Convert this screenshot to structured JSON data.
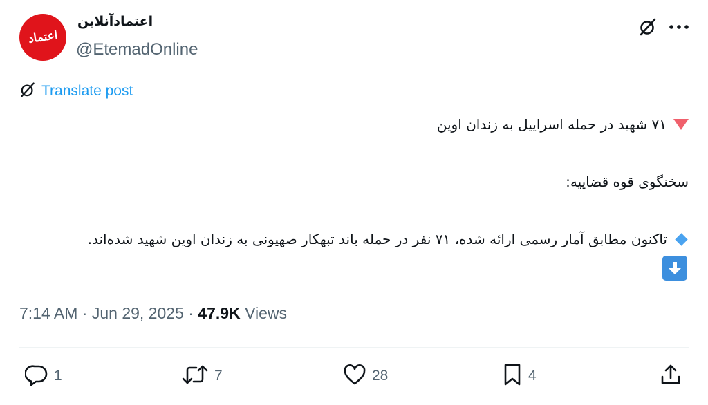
{
  "author": {
    "display_name": "اعتمادآنلاین",
    "handle": "@EtemadOnline",
    "avatar_text": "اعتماد"
  },
  "header": {
    "grok_icon": "grok-icon",
    "more_icon": "more-icon"
  },
  "translate": {
    "label": "Translate post",
    "icon": "grok-icon"
  },
  "post": {
    "line1": "۷۱ شهید در حمله اسراییل به زندان اوین",
    "line1_icon": "red-triangle-down-icon",
    "line2": "سخنگوی قوه قضاییه:",
    "line3": "تاکنون مطابق آمار رسمی ارائه شده، ۷۱ نفر در حمله باند تبهکار صهیونی به زندان اوین شهید شده‌اند.",
    "line3_icon": "blue-diamond-icon",
    "trailing_icon": "down-arrow-box-icon"
  },
  "meta": {
    "time": "7:14 AM",
    "separator": "·",
    "date": "Jun 29, 2025",
    "views_count": "47.9K",
    "views_label": "Views"
  },
  "actions": {
    "replies": "1",
    "reposts": "7",
    "likes": "28",
    "bookmarks": "4"
  },
  "colors": {
    "accent": "#1d9bf0",
    "text_primary": "#0f1419",
    "text_secondary": "#536471",
    "avatar_bg": "#e0141b",
    "triangle": "#f0606c",
    "diamond": "#4aa3f0",
    "arrow_box": "#3d8fde"
  }
}
